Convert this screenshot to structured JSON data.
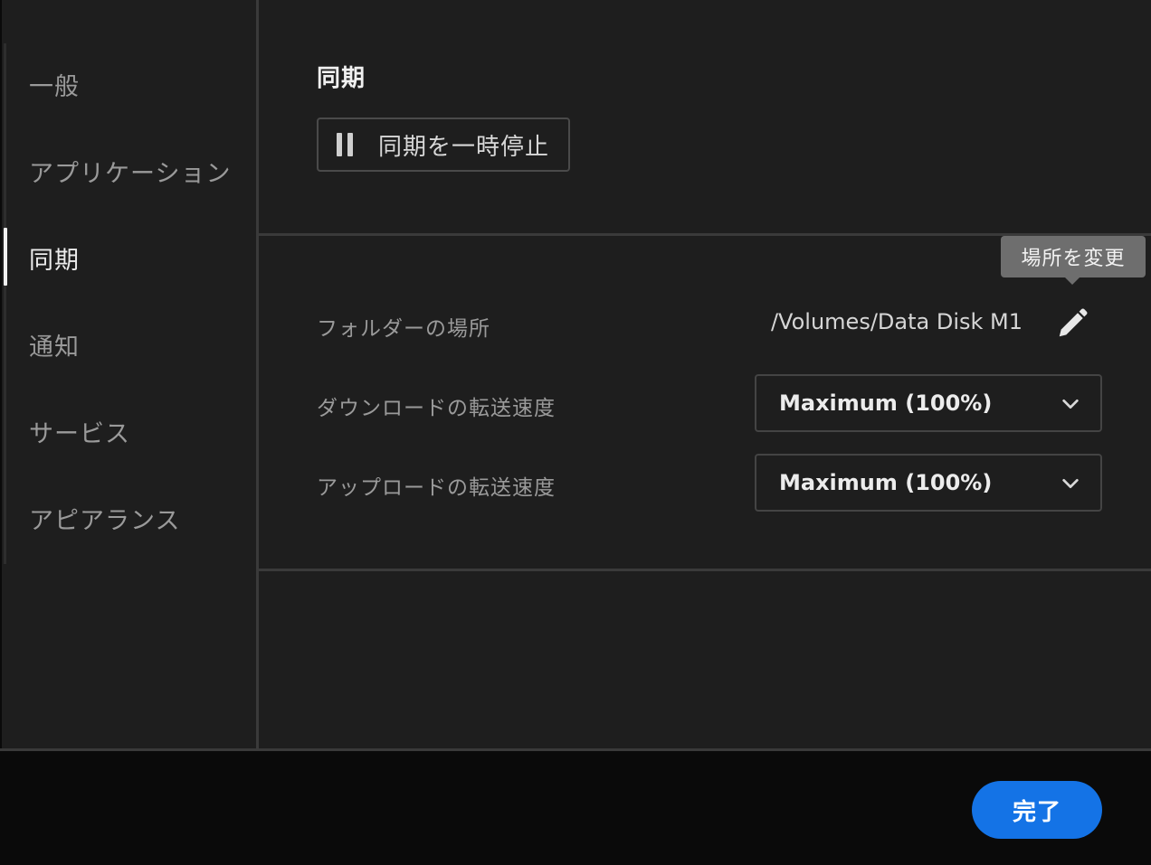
{
  "sidebar": {
    "items": [
      {
        "label": "一般"
      },
      {
        "label": "アプリケーション"
      },
      {
        "label": "同期"
      },
      {
        "label": "通知"
      },
      {
        "label": "サービス"
      },
      {
        "label": "アピアランス"
      }
    ],
    "active_item": "同期"
  },
  "sync_section": {
    "title": "同期",
    "pause_button_label": "同期を一時停止"
  },
  "settings": {
    "folder_location_label": "フォルダーの場所",
    "folder_path": "/Volumes/Data Disk M1",
    "edit_tooltip": "場所を変更",
    "download_speed_label": "ダウンロードの転送速度",
    "download_speed_value": "Maximum (100%)",
    "upload_speed_label": "アップロードの転送速度",
    "upload_speed_value": "Maximum (100%)"
  },
  "footer": {
    "done_label": "完了"
  },
  "colors": {
    "background": "#1e1e1e",
    "footer": "#0a0a0a",
    "accent": "#1473e6",
    "tooltip": "#6e6e6e"
  },
  "icons": {
    "pause": "pause-icon",
    "edit": "pencil-icon",
    "dropdown": "chevron-down-icon"
  }
}
